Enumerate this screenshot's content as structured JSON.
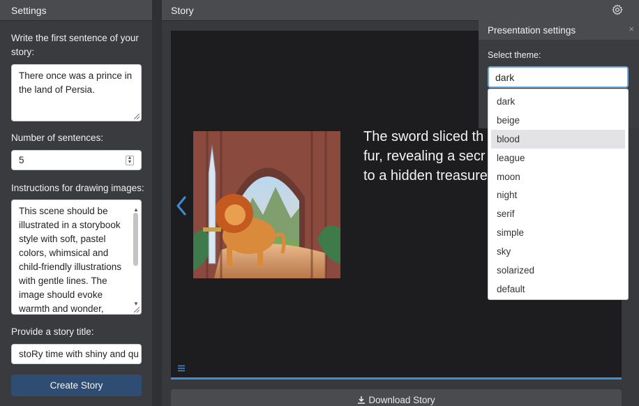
{
  "settings": {
    "title": "Settings",
    "first_sentence_label": "Write the first sentence of your story:",
    "first_sentence_value": "There once was a prince in the land of Persia.",
    "num_sentences_label": "Number of sentences:",
    "num_sentences_value": "5",
    "instructions_label": "Instructions for drawing images:",
    "instructions_value": "This scene should be illustrated in a storybook style with soft, pastel colors, whimsical and child-friendly illustrations with gentle lines. The image should evoke warmth and wonder,",
    "story_title_label": "Provide a story title:",
    "story_title_value": "stoRy time with shiny and qu",
    "create_button": "Create Story"
  },
  "story": {
    "title": "Story",
    "slide_lines": [
      "The sword sliced th",
      "fur, revealing a secr",
      "to a hidden treasure"
    ],
    "download_button": "Download Story"
  },
  "presentation": {
    "title": "Presentation settings",
    "close": "×",
    "select_label": "Select theme:",
    "selected_value": "dark",
    "options": [
      "dark",
      "beige",
      "blood",
      "league",
      "moon",
      "night",
      "serif",
      "simple",
      "sky",
      "solarized",
      "default"
    ],
    "highlighted": "blood"
  },
  "colors": {
    "accent": "#3d8fd4",
    "create_button": "#2f4d72",
    "slide_bg": "#1d1d1f"
  },
  "icons": [
    "gear-icon",
    "close-icon",
    "chevron-left-icon",
    "menu-icon",
    "download-icon",
    "resize-grip-icon",
    "spinner-icon"
  ]
}
